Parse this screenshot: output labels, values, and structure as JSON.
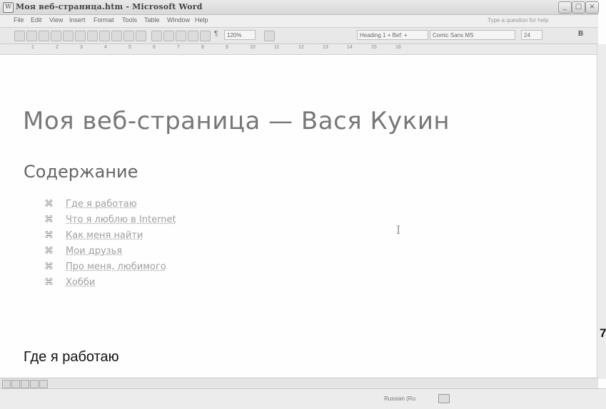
{
  "window": {
    "title": "Моя веб-страница.htm - Microsoft Word",
    "buttons": [
      "_",
      "□",
      "×"
    ]
  },
  "menu": {
    "items": [
      "File",
      "Edit",
      "View",
      "Insert",
      "Format",
      "Tools",
      "Table",
      "Window",
      "Help"
    ],
    "help_placeholder": "Type a question for help"
  },
  "toolbar": {
    "zoom": "120%",
    "style": "Heading 1 + Bef: +",
    "font": "Comic Sans MS",
    "size": "24",
    "bold": "B",
    "paragraph_mark": "¶"
  },
  "ruler": {
    "numbers": [
      "1",
      "2",
      "3",
      "4",
      "5",
      "6",
      "7",
      "8",
      "9",
      "10",
      "11",
      "12",
      "13",
      "14",
      "15",
      "16"
    ]
  },
  "document": {
    "heading1": "Моя веб-страница — Вася Кукин",
    "heading2": "Содержание",
    "bullet": "⌘",
    "toc": [
      "Где я работаю",
      "Что я люблю в Internet",
      "Как меня найти",
      "Мои друзья",
      "Про меня, любимого",
      "Хобби"
    ],
    "section_heading": "Где я работаю",
    "cursor": "I"
  },
  "page_number": "7",
  "status": {
    "language": "Russian (Ru"
  }
}
